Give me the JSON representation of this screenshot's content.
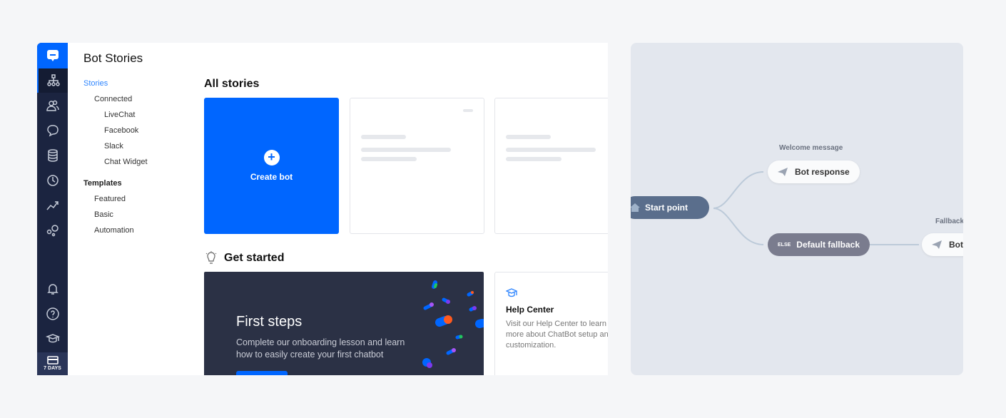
{
  "sidebar": {
    "icons": [
      "chatbot-logo",
      "stories-icon",
      "users-icon",
      "chat-icon",
      "database-icon",
      "history-icon",
      "reports-icon",
      "integrations-icon",
      "bell-icon",
      "help-icon",
      "academy-icon",
      "billing-icon"
    ],
    "trial_label": "7 DAYS"
  },
  "header": {
    "title": "Bot Stories"
  },
  "nav": {
    "stories": "Stories",
    "connected": "Connected",
    "connected_items": [
      "LiveChat",
      "Facebook",
      "Slack",
      "Chat Widget"
    ],
    "templates": "Templates",
    "template_items": [
      "Featured",
      "Basic",
      "Automation"
    ]
  },
  "main": {
    "all_stories": "All stories",
    "create_bot": "Create bot",
    "get_started": "Get started",
    "first_steps": {
      "title": "First steps",
      "description": "Complete our onboarding lesson and learn how to easily create your first chatbot"
    },
    "help_center": {
      "title": "Help Center",
      "description": "Visit our Help Center to learn more about ChatBot setup and customization."
    }
  },
  "flow": {
    "start": "Start point",
    "welcome_label": "Welcome message",
    "bot_response": "Bot response",
    "else_badge": "ELSE",
    "default_fallback": "Default fallback",
    "fallback_label": "Fallback",
    "fallback_response": "Bot response"
  },
  "colors": {
    "accent": "#0066ff",
    "rail": "#1b2440",
    "start_node": "#5a6e8c",
    "fallback_node": "#7a7c8e"
  }
}
